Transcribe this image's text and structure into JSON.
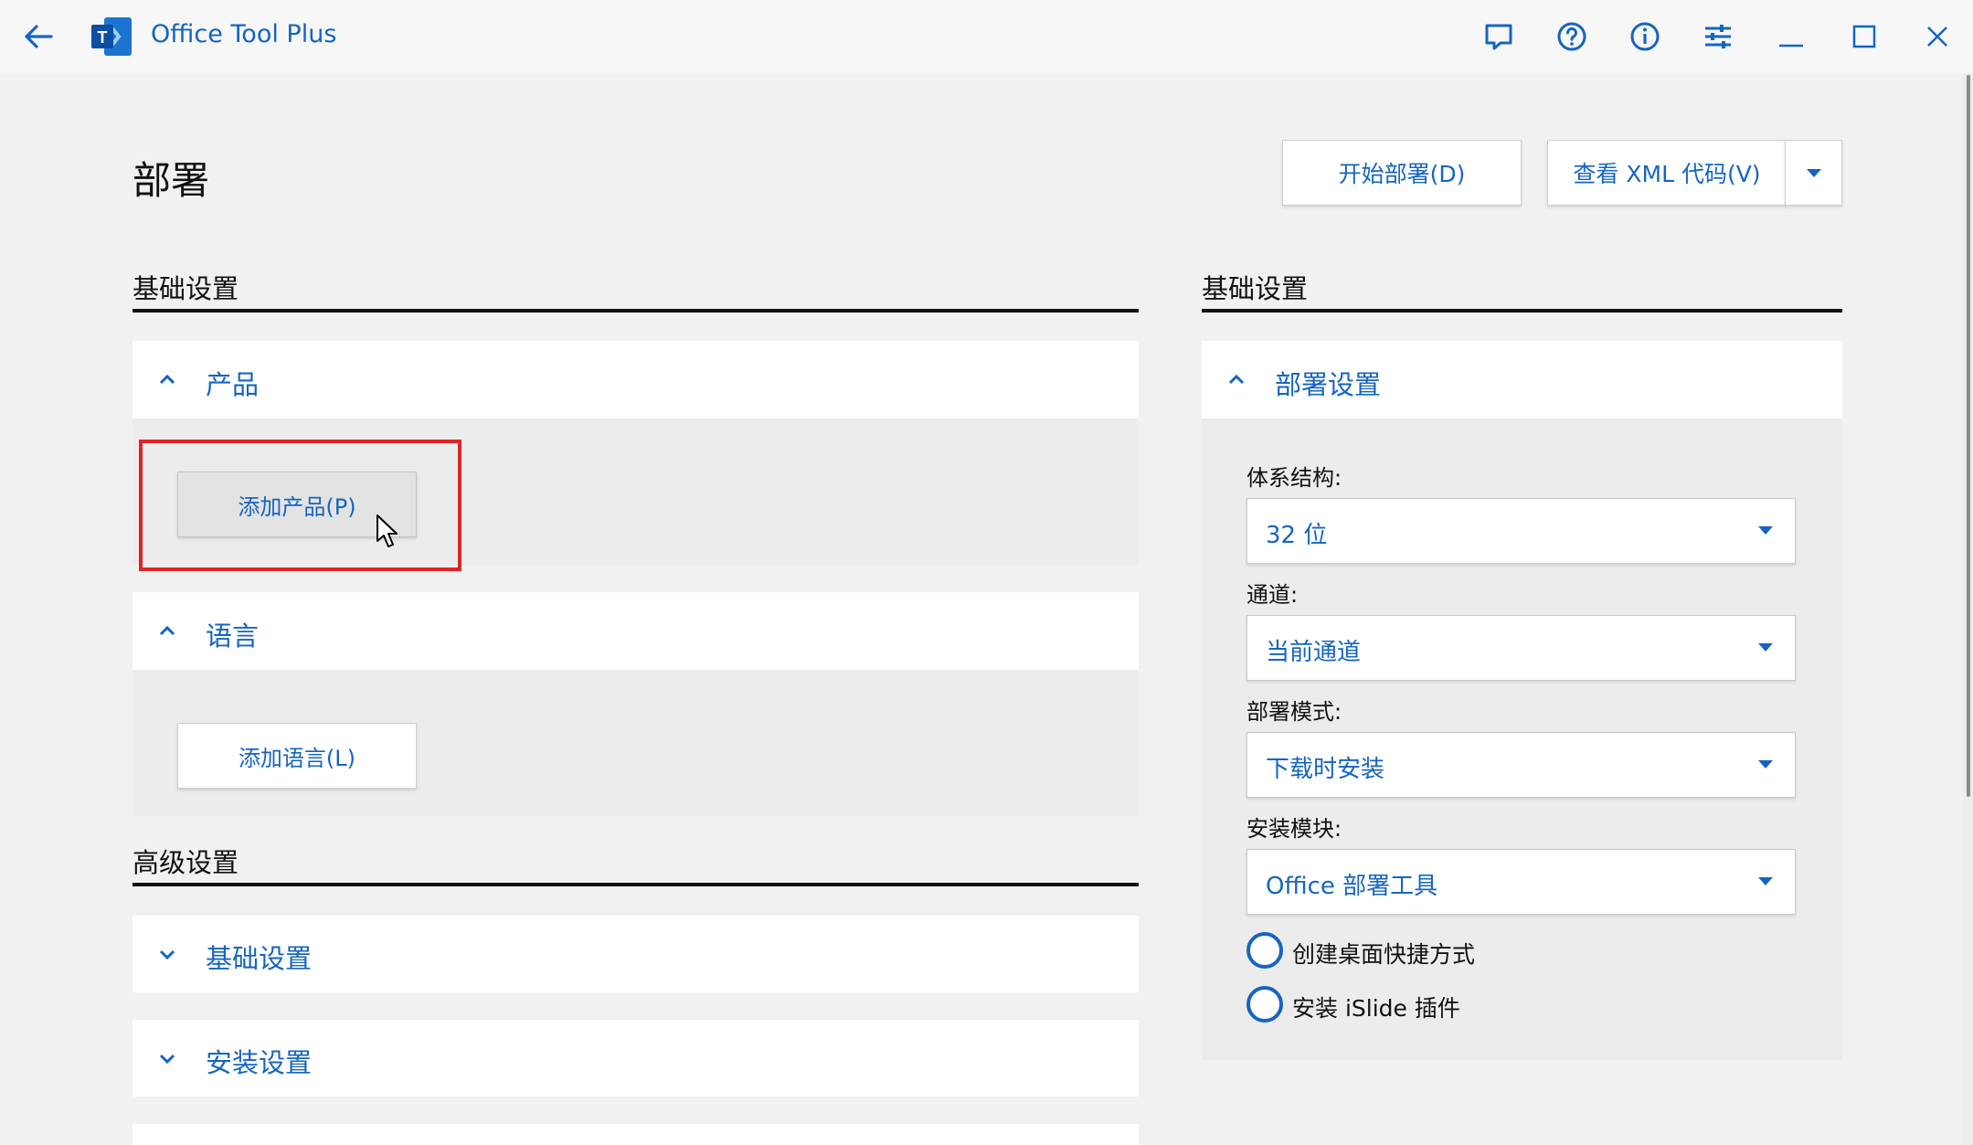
{
  "app": {
    "title": "Office Tool Plus",
    "colors": {
      "accent": "#1565c0",
      "highlight": "#e02424",
      "background": "#f1f1f1"
    },
    "titlebar_icons": [
      "back-arrow-icon",
      "app-logo-icon",
      "feedback-icon",
      "help-icon",
      "info-icon",
      "settings-sliders-icon",
      "minimize-icon",
      "maximize-icon",
      "close-icon"
    ]
  },
  "page": {
    "title": "部署",
    "start_deploy_label": "开始部署(D)",
    "view_xml_label": "查看 XML 代码(V)"
  },
  "left": {
    "basic_header": "基础设置",
    "product_panel": {
      "title": "产品",
      "add_button": "添加产品(P)"
    },
    "language_panel": {
      "title": "语言",
      "add_button": "添加语言(L)"
    },
    "advanced_header": "高级设置",
    "advanced_panels": [
      "基础设置",
      "安装设置"
    ]
  },
  "right": {
    "basic_header": "基础设置",
    "deploy_panel": {
      "title": "部署设置",
      "fields": [
        {
          "label": "体系结构:",
          "value": "32 位"
        },
        {
          "label": "通道:",
          "value": "当前通道"
        },
        {
          "label": "部署模式:",
          "value": "下载时安装"
        },
        {
          "label": "安装模块:",
          "value": "Office 部署工具"
        }
      ],
      "options": [
        "创建桌面快捷方式",
        "安装 iSlide 插件"
      ]
    }
  }
}
